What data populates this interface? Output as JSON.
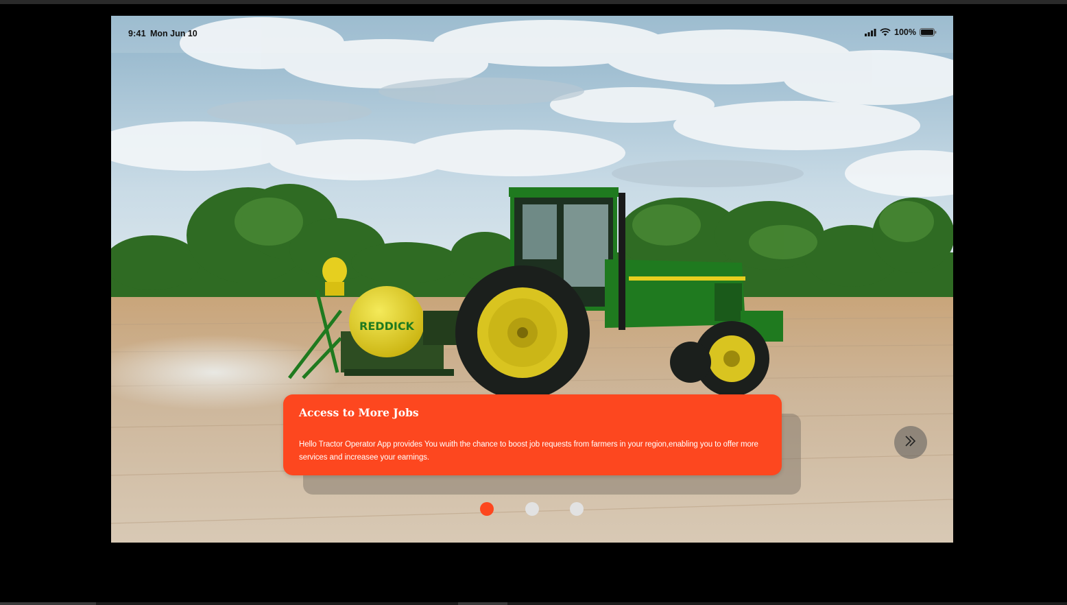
{
  "status_bar": {
    "time": "9:41",
    "date": "Mon Jun 10",
    "battery": "100%",
    "icons": [
      "cellular-icon",
      "wifi-icon",
      "battery-icon"
    ]
  },
  "hero_image": {
    "tank_label": "REDDICK"
  },
  "onboarding_card": {
    "title": "Access to More Jobs",
    "body": "Hello Tractor Operator App provides You wuith the chance to boost job requests from farmers in your region,enabling you to offer more services and increasee your earnings."
  },
  "pagination": {
    "total": 3,
    "active_index": 0
  },
  "next_button": {
    "icon": "double-chevron-right-icon"
  },
  "colors": {
    "accent": "#fd471f",
    "inactive_dot": "#e2e2e2",
    "tractor_green": "#1f7a1f",
    "tank_yellow": "#e6d21a"
  }
}
